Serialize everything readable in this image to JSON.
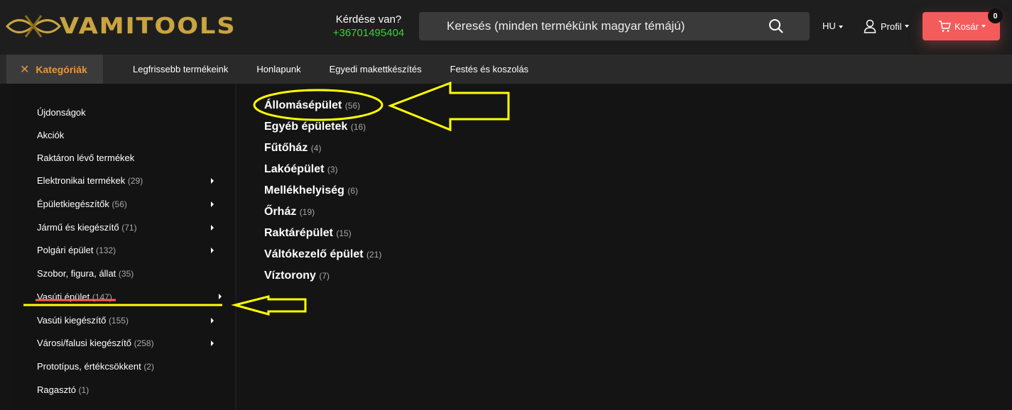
{
  "brand": {
    "name": "VAMITOOLS",
    "accent": "#c9a441"
  },
  "contact": {
    "question": "Kérdése van?",
    "phone": "+36701495404",
    "phone_color": "#3ad13a"
  },
  "search": {
    "placeholder": "Keresés (minden termékünk magyar témájú)",
    "icon": "search-icon"
  },
  "header": {
    "language": "HU",
    "profile": "Profil",
    "cart": "Kosár",
    "cart_count": "0",
    "cart_color": "#f45b5b"
  },
  "nav": {
    "categories_label": "Kategóriák",
    "categories_icon": "close-icon",
    "links": [
      "Legfrissebb termékeink",
      "Honlapunk",
      "Egyedi makettkészítés",
      "Festés és koszolás"
    ]
  },
  "sidebar": {
    "items": [
      {
        "label": "Újdonságok",
        "count": ""
      },
      {
        "label": "Akciók",
        "count": ""
      },
      {
        "label": "Raktáron lévő termékek",
        "count": ""
      },
      {
        "label": "Elektronikai termékek",
        "count": "(29)"
      },
      {
        "label": "Épületkiegészítők",
        "count": "(56)"
      },
      {
        "label": "Jármű és kiegészítő",
        "count": "(71)"
      },
      {
        "label": "Polgári épület",
        "count": "(132)"
      },
      {
        "label": "Szobor, figura, állat",
        "count": "(35)"
      },
      {
        "label": "Vasúti épület",
        "count": "(147)"
      },
      {
        "label": "Vasúti kiegészítő",
        "count": "(155)"
      },
      {
        "label": "Városi/falusi kiegészítő",
        "count": "(258)"
      },
      {
        "label": "Prototípus, értékcsökkent",
        "count": "(2)"
      },
      {
        "label": "Ragasztó",
        "count": "(1)"
      }
    ]
  },
  "submenu": {
    "items": [
      {
        "label": "Állomásépület",
        "count": "(56)"
      },
      {
        "label": "Egyéb épületek",
        "count": "(16)"
      },
      {
        "label": "Fűtőház",
        "count": "(4)"
      },
      {
        "label": "Lakóépület",
        "count": "(3)"
      },
      {
        "label": "Mellékhelyiség",
        "count": "(6)"
      },
      {
        "label": "Őrház",
        "count": "(19)"
      },
      {
        "label": "Raktárépület",
        "count": "(15)"
      },
      {
        "label": "Váltókezelő épület",
        "count": "(21)"
      },
      {
        "label": "Víztorony",
        "count": "(7)"
      }
    ]
  },
  "annotations": {
    "color": "#ffff00",
    "underline_color": "#ff5a5a"
  }
}
